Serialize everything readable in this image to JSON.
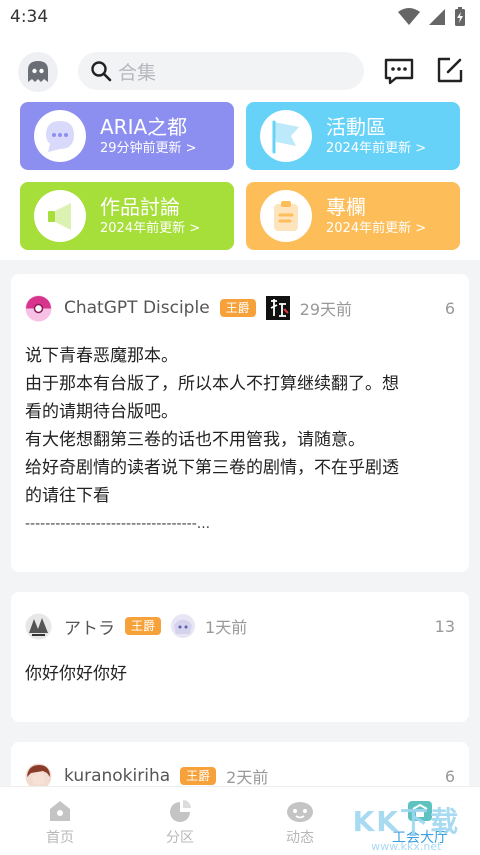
{
  "status": {
    "time": "4:34"
  },
  "search": {
    "placeholder": "合集"
  },
  "tiles": [
    {
      "name": "ARIA之都",
      "sub": "29分钟前更新 >",
      "color": "#8c8ff0"
    },
    {
      "name": "活動區",
      "sub": "2024年前更新 >",
      "color": "#66d2f8"
    },
    {
      "name": "作品討論",
      "sub": "2024年前更新 >",
      "color": "#a6de3a"
    },
    {
      "name": "專欄",
      "sub": "2024年前更新 >",
      "color": "#fdbd59"
    }
  ],
  "posts": [
    {
      "user": "ChatGPT Disciple",
      "badge": "王爵",
      "time": "29天前",
      "count": "6",
      "lines": [
        "说下青春恶魔那本。",
        "由于那本有台版了，所以本人不打算继续翻了。想",
        "看的请期待台版吧。",
        "有大佬想翻第三卷的话也不用管我，请随意。",
        "给好奇剧情的读者说下第三卷的剧情，不在乎剧透",
        "的请往下看",
        "----------------------------------..."
      ]
    },
    {
      "user": "アトラ",
      "badge": "王爵",
      "time": "1天前",
      "count": "13",
      "lines": [
        "你好你好你好"
      ]
    },
    {
      "user": "kuranokiriha",
      "badge": "王爵",
      "time": "2天前",
      "count": "6",
      "lines": []
    }
  ],
  "nav": [
    {
      "label": "首页",
      "icon": "home-icon"
    },
    {
      "label": "分区",
      "icon": "category-icon"
    },
    {
      "label": "动态",
      "icon": "feed-icon"
    },
    {
      "label": "工会大厅",
      "icon": "guild-icon"
    }
  ],
  "watermark": {
    "main": "KK下载",
    "sub": "www.kkx.net"
  },
  "colors": {
    "accent": "#3a9fe0",
    "badge": "#f7a13a"
  }
}
